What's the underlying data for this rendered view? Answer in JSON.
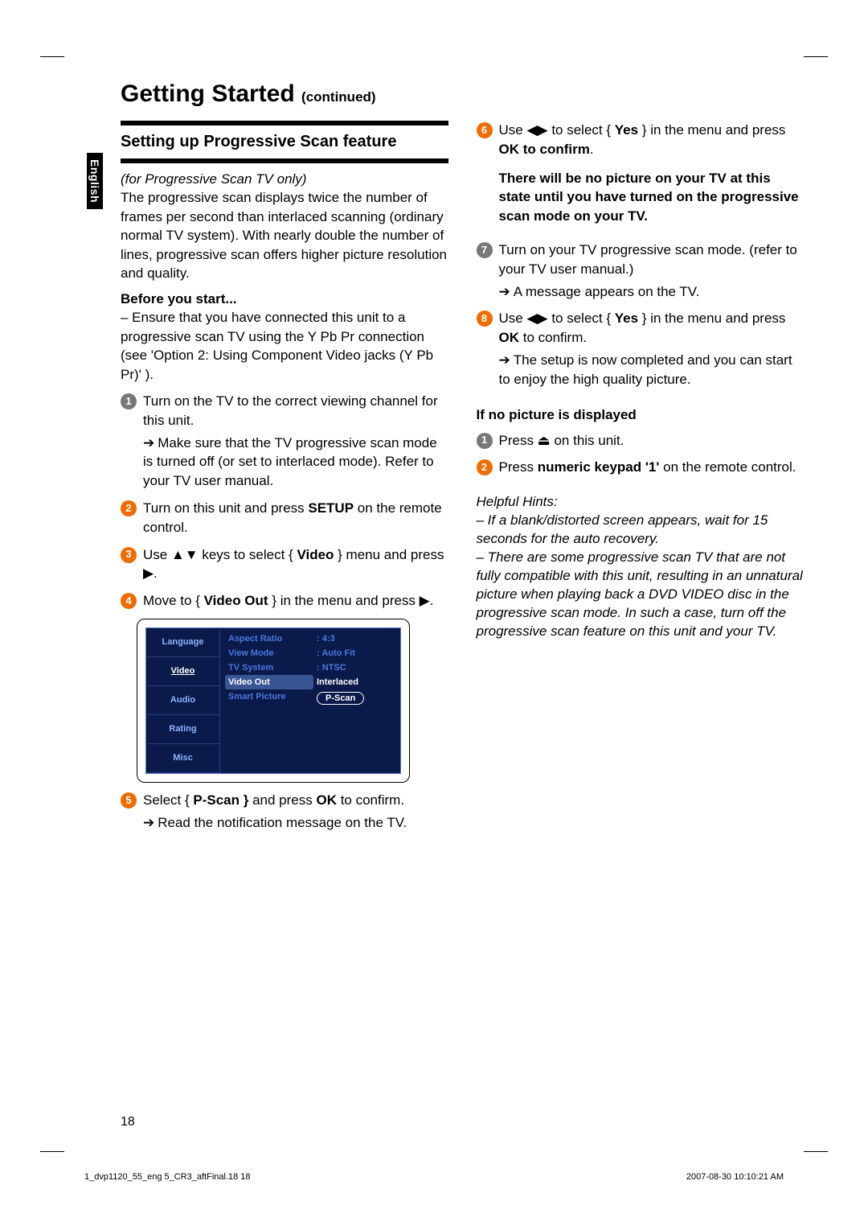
{
  "side_label": "English",
  "title": "Getting Started",
  "title_continued": "(continued)",
  "subhead": "Setting up Progressive Scan feature",
  "intro_em": "(for Progressive Scan TV only)",
  "intro_para": "The progressive scan displays twice the number of frames per second than interlaced scanning (ordinary normal TV system). With nearly double the number of lines, progressive scan offers higher picture resolution and quality.",
  "before_head": "Before you start...",
  "before_text": "–  Ensure that you have connected this unit to a progressive scan TV using the Y Pb Pr connection (see 'Option 2: Using Component Video jacks (Y Pb Pr)' ).",
  "step1a": "Turn on the TV to the correct viewing channel for this unit.",
  "step1b": "Make sure that the TV progressive scan mode is turned off (or set to interlaced mode). Refer to your TV user manual.",
  "step2": "Turn on this unit and press ",
  "step2_bold": "SETUP",
  "step2_end": " on the remote control.",
  "step3_pre": "Use ▲▼ keys to select { ",
  "step3_bold": "Video",
  "step3_post": " } menu and press ▶.",
  "step4_pre": "Move to { ",
  "step4_bold": "Video Out",
  "step4_post": " } in the menu and press ▶.",
  "menu": {
    "tabs": [
      "Language",
      "Video",
      "Audio",
      "Rating",
      "Misc"
    ],
    "active": "Video",
    "rows": [
      "Aspect Ratio",
      "View Mode",
      "TV System",
      "Video Out",
      "Smart Picture"
    ],
    "vals": [
      "4:3",
      "Auto Fit",
      "NTSC",
      "Interlaced",
      "P-Scan"
    ]
  },
  "step5_pre": "Select { ",
  "step5_bold": "P-Scan }",
  "step5_mid": " and press ",
  "step5_bold2": "OK",
  "step5_post": " to confirm.",
  "step5_sub": "Read the notification message on the TV.",
  "step6_pre": "Use ◀▶ to select { ",
  "step6_bold": "Yes",
  "step6_mid": " } in the menu and press ",
  "step6_bold2": "OK to confirm",
  "step6_post": ".",
  "step6_note": "There will be no picture on your TV at this state until you have turned on the progressive scan mode on your TV.",
  "step7a": "Turn on your TV progressive scan mode. (refer to your TV user manual.)",
  "step7b": "A message appears on the TV.",
  "step8_pre": "Use ◀▶ to select { ",
  "step8_bold": "Yes",
  "step8_mid": " } in the menu and press ",
  "step8_bold2": "OK",
  "step8_post": " to confirm.",
  "step8_sub": "The setup is now completed and you can start to enjoy the high quality picture.",
  "ifnopic_head": "If no picture is displayed",
  "ifnopic_1": "Press ⏏ on this unit.",
  "ifnopic_2_pre": "Press ",
  "ifnopic_2_bold": "numeric keypad '1'",
  "ifnopic_2_post": " on the remote control.",
  "hints_head": "Helpful Hints:",
  "hints_1": "–  If a blank/distorted screen appears, wait for 15 seconds for the auto recovery.",
  "hints_2": "–  There are some progressive scan TV that are not fully compatible with this unit, resulting in an unnatural picture when playing back a DVD VIDEO disc in the progressive scan mode. In such a case, turn off the progressive scan feature on this unit and your TV.",
  "page_num": "18",
  "footer_l": "1_dvp1120_55_eng 5_CR3_aftFinal.18   18",
  "footer_r": "2007-08-30   10:10:21 AM"
}
